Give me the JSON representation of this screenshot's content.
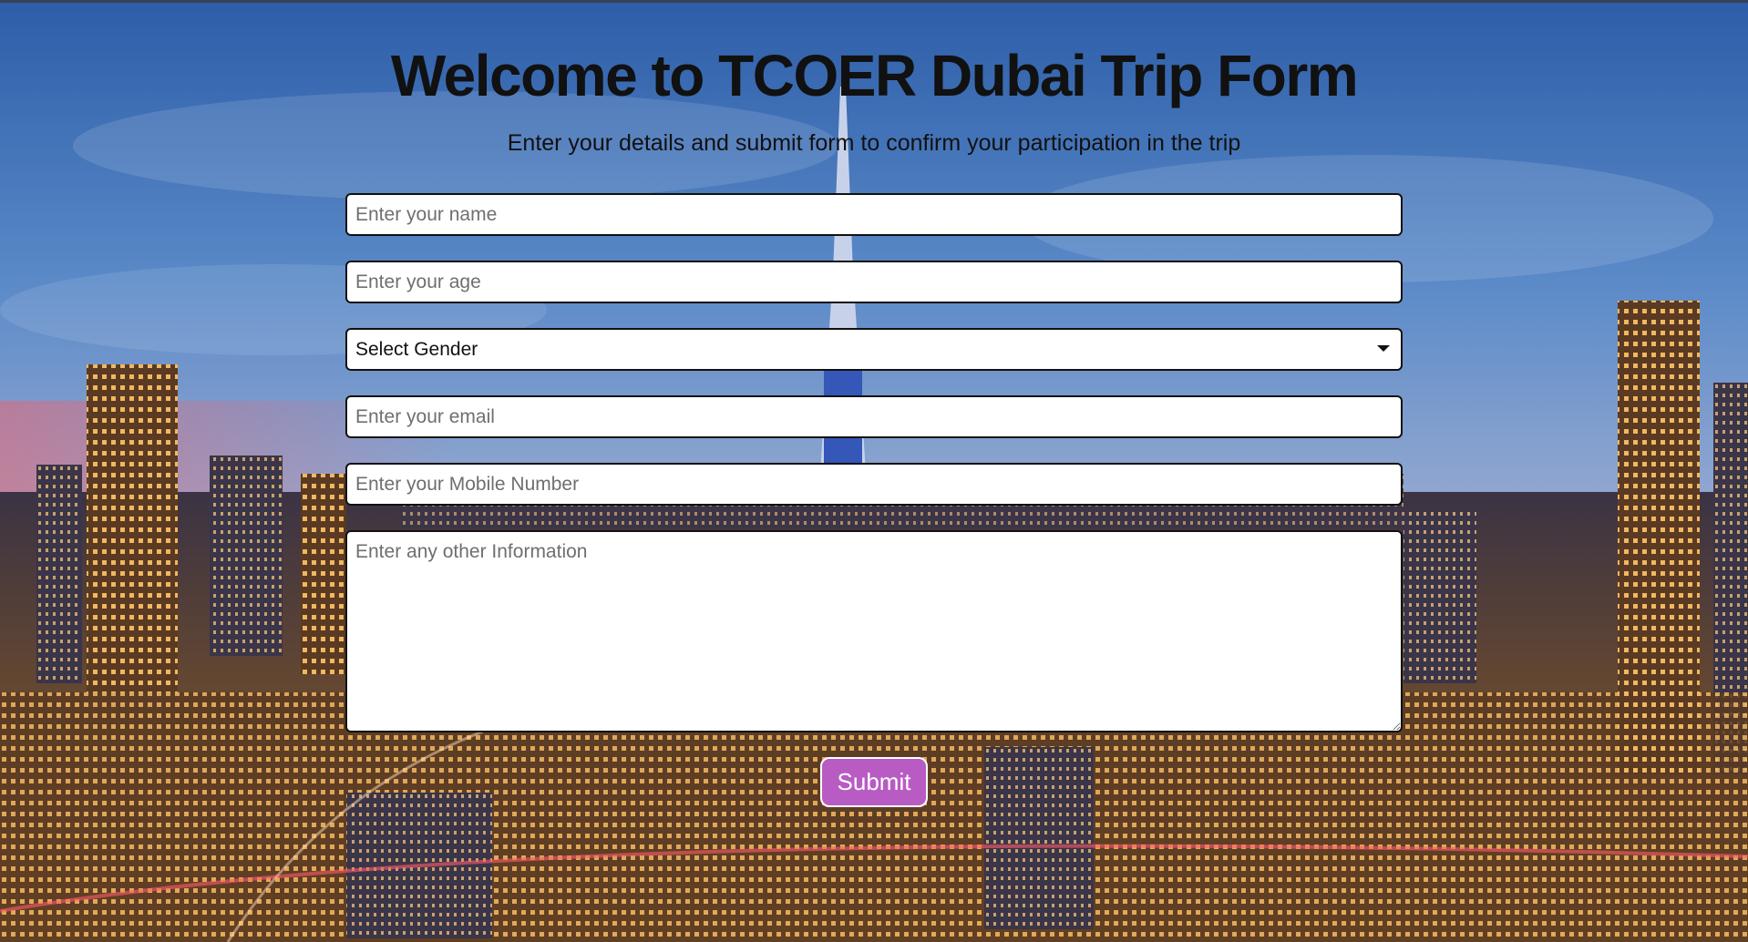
{
  "header": {
    "title": "Welcome to TCOER Dubai Trip Form",
    "subtitle": "Enter your details and submit form to confirm your participation in the trip"
  },
  "form": {
    "name_placeholder": "Enter your name",
    "age_placeholder": "Enter your age",
    "gender_selected": "Select Gender",
    "email_placeholder": "Enter your email",
    "mobile_placeholder": "Enter your Mobile Number",
    "info_placeholder": "Enter any other Information",
    "submit_label": "Submit"
  },
  "colors": {
    "title_text": "#111111",
    "submit_background": "#b85cc4",
    "field_background": "#ffffff",
    "field_border": "#111111"
  },
  "icons": {
    "gender_dropdown": "caret-down-icon"
  }
}
